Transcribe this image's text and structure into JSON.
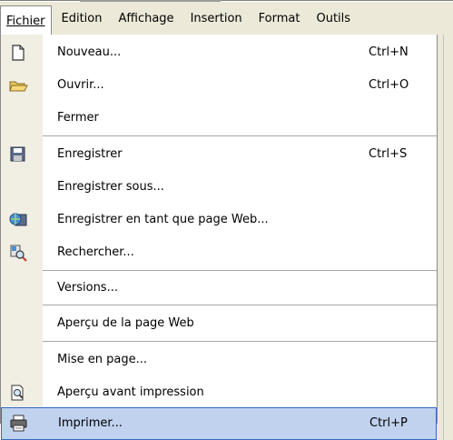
{
  "menubar": {
    "items": [
      {
        "label": "Fichier",
        "active": true
      },
      {
        "label": "Edition"
      },
      {
        "label": "Affichage"
      },
      {
        "label": "Insertion"
      },
      {
        "label": "Format"
      },
      {
        "label": "Outils"
      }
    ]
  },
  "menu": {
    "items": [
      {
        "label": "Nouveau...",
        "shortcut": "Ctrl+N",
        "icon": "new-document-icon"
      },
      {
        "label": "Ouvrir...",
        "shortcut": "Ctrl+O",
        "icon": "open-folder-icon"
      },
      {
        "label": "Fermer",
        "shortcut": ""
      },
      {
        "label": "Enregistrer",
        "shortcut": "Ctrl+S",
        "icon": "save-disk-icon"
      },
      {
        "label": "Enregistrer sous...",
        "shortcut": ""
      },
      {
        "label": "Enregistrer en tant que page Web...",
        "shortcut": "",
        "icon": "save-web-icon"
      },
      {
        "label": "Rechercher...",
        "shortcut": "",
        "icon": "search-file-icon"
      },
      {
        "label": "Versions...",
        "shortcut": ""
      },
      {
        "label": "Aperçu de la page Web",
        "shortcut": ""
      },
      {
        "label": "Mise en page...",
        "shortcut": ""
      },
      {
        "label": "Aperçu avant impression",
        "shortcut": "",
        "icon": "print-preview-icon"
      },
      {
        "label": "Imprimer...",
        "shortcut": "Ctrl+P",
        "icon": "printer-icon",
        "highlighted": true
      }
    ]
  },
  "colors": {
    "highlight": "#c1d2ee",
    "highlight_border": "#316ac5",
    "gutter": "#f1efe4",
    "menubar": "#ece9d8"
  }
}
